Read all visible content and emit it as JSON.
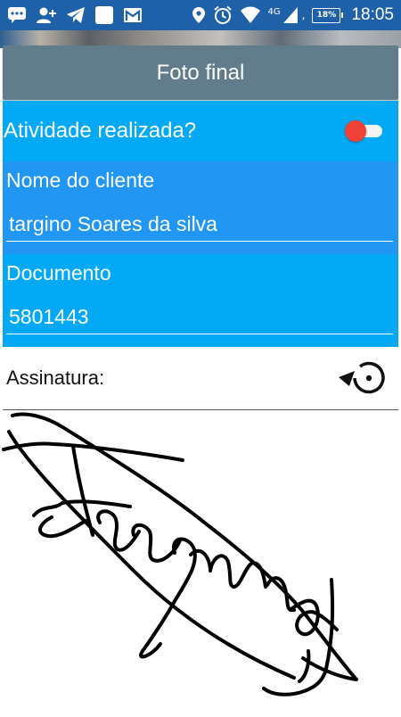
{
  "status_bar": {
    "time": "18:05",
    "battery": "18%",
    "network": "4G",
    "icons": [
      "chat-icon",
      "add-contact-icon",
      "telegram-icon",
      "square-icon",
      "gmail-icon",
      "location-icon",
      "alarm-icon",
      "wifi-icon",
      "signal-icon",
      "battery-icon"
    ]
  },
  "header": {
    "photo_button_label": "Foto final"
  },
  "form": {
    "activity_label": "Atividade realizada?",
    "activity_toggle_on": false,
    "client_label": "Nome do cliente",
    "client_value": "targino Soares da silva",
    "document_label": "Documento",
    "document_value": "5801443"
  },
  "signature": {
    "label": "Assinatura:",
    "reset_icon": "rotate-reset-icon"
  },
  "colors": {
    "status_bar": "#1f61a8",
    "button": "#617d8b",
    "panel_light": "#03a9f4",
    "panel_dark": "#2196f3",
    "toggle_thumb": "#ef4135"
  }
}
